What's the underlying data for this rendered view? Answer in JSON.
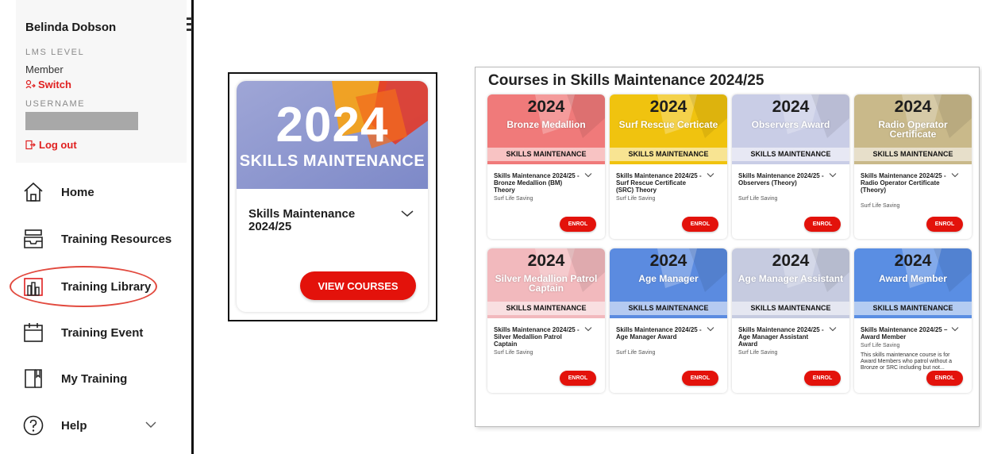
{
  "user": {
    "name": "Belinda Dobson",
    "lms_level_label": "LMS LEVEL",
    "lms_level_value": "Member",
    "switch_label": "Switch",
    "username_label": "USERNAME",
    "logout_label": "Log out"
  },
  "nav": [
    {
      "label": "Home",
      "icon": "home-icon"
    },
    {
      "label": "Training Resources",
      "icon": "tray-icon"
    },
    {
      "label": "Training Library",
      "icon": "library-icon",
      "active": true
    },
    {
      "label": "Training Event",
      "icon": "calendar-icon"
    },
    {
      "label": "My Training",
      "icon": "book-icon"
    },
    {
      "label": "Help",
      "icon": "help-icon"
    }
  ],
  "featured": {
    "year": "2024",
    "banner_text": "SKILLS MAINTENANCE",
    "title": "Skills Maintenance 2024/25",
    "button_label": "VIEW COURSES"
  },
  "catalog": {
    "heading": "Courses in Skills Maintenance 2024/25",
    "enrol_label": "ENROL",
    "courses": [
      {
        "year": "2024",
        "banner_name": "Bronze Medallion",
        "strip": "SKILLS MAINTENANCE",
        "title": "Skills Maintenance 2024/25 - Bronze Medallion (BM) Theory",
        "org": "Surf Life Saving",
        "description": "",
        "color": "#f07a7a"
      },
      {
        "year": "2024",
        "banner_name": "Surf Rescue Certicate",
        "strip": "SKILLS MAINTENANCE",
        "title": "Skills Maintenance 2024/25 - Surf Rescue Certificate (SRC) Theory",
        "org": "Surf Life Saving",
        "description": "",
        "color": "#f0c30f"
      },
      {
        "year": "2024",
        "banner_name": "Observers Award",
        "strip": "SKILLS MAINTENANCE",
        "title": "Skills Maintenance 2024/25 - Observers (Theory)",
        "org": "Surf Life Saving",
        "description": "",
        "color": "#c9cde6"
      },
      {
        "year": "2024",
        "banner_name": "Radio Operator Certificate",
        "strip": "SKILLS MAINTENANCE",
        "title": "Skills Maintenance 2024/25 - Radio Operator Certificate (Theory)",
        "org": "Surf Life Saving",
        "description": "",
        "color": "#c9b98a"
      },
      {
        "year": "2024",
        "banner_name": "Silver Medallion Patrol Captain",
        "strip": "SKILLS MAINTENANCE",
        "title": "Skills Maintenance 2024/25 - Silver Medallion Patrol Captain",
        "org": "Surf Life Saving",
        "description": "",
        "color": "#f2b9bd"
      },
      {
        "year": "2024",
        "banner_name": "Age Manager",
        "strip": "SKILLS MAINTENANCE",
        "title": "Skills Maintenance 2024/25 - Age Manager Award",
        "org": "Surf Life Saving",
        "description": "",
        "color": "#5b8be0"
      },
      {
        "year": "2024",
        "banner_name": "Age Manager Assistant",
        "strip": "SKILLS MAINTENANCE",
        "title": "Skills Maintenance 2024/25 - Age Manager Assistant Award",
        "org": "Surf Life Saving",
        "description": "",
        "color": "#c6cbe0"
      },
      {
        "year": "2024",
        "banner_name": "Award Member",
        "strip": "SKILLS MAINTENANCE",
        "title": "Skills Maintenance 2024/25 – Award Member",
        "org": "Surf Life Saving",
        "description": "This skills maintenance course is for Award Members who patrol without a Bronze or SRC including but not...",
        "color": "#5a8ee3"
      }
    ]
  }
}
